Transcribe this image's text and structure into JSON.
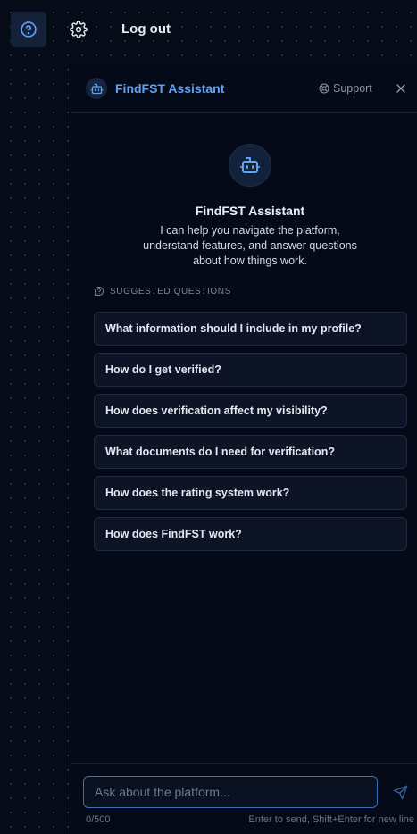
{
  "topbar": {
    "help_icon": "question-circle-icon",
    "settings_icon": "gear-icon",
    "logout_label": "Log out"
  },
  "assistant": {
    "header": {
      "icon": "bot-icon",
      "title": "FindFST Assistant",
      "support_icon": "life-buoy-icon",
      "support_label": "Support",
      "close_icon": "close-icon"
    },
    "hero": {
      "icon": "bot-icon",
      "title": "FindFST Assistant",
      "description": "I can help you navigate the platform, understand features, and answer questions about how things work."
    },
    "suggested": {
      "icon": "message-question-icon",
      "label": "SUGGESTED QUESTIONS",
      "questions": [
        "What information should I include in my profile?",
        "How do I get verified?",
        "How does verification affect my visibility?",
        "What documents do I need for verification?",
        "How does the rating system work?",
        "How does FindFST work?"
      ]
    },
    "composer": {
      "placeholder": "Ask about the platform...",
      "value": "",
      "counter": "0/500",
      "hint": "Enter to send, Shift+Enter for new line",
      "send_icon": "send-icon"
    }
  },
  "colors": {
    "background": "#060b18",
    "accent": "#5ea3f5",
    "input_border": "#3b6fb8"
  }
}
